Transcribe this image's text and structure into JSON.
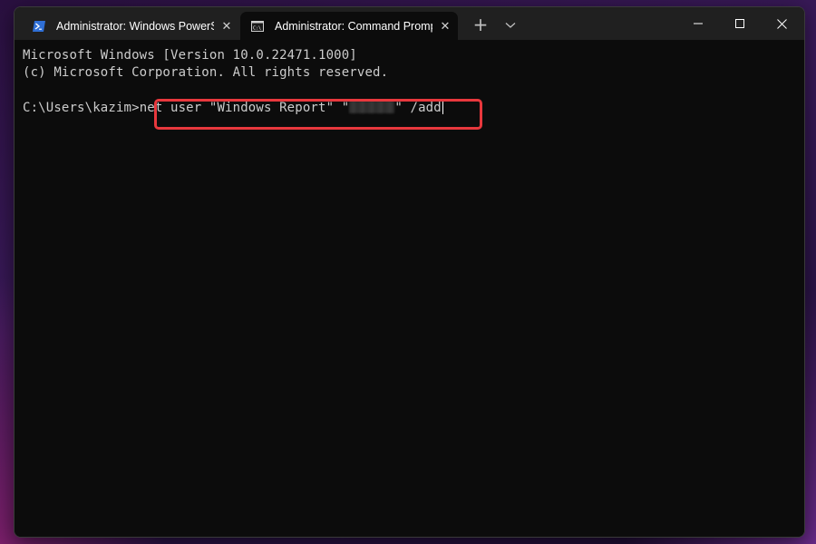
{
  "tabs": [
    {
      "title": "Administrator: Windows PowerShell",
      "icon": "powershell-icon",
      "active": false
    },
    {
      "title": "Administrator: Command Prompt",
      "icon": "cmd-icon",
      "active": true
    }
  ],
  "titlebar": {
    "new_tab_glyph": "+",
    "close_glyph": "✕"
  },
  "terminal": {
    "lines": [
      "Microsoft Windows [Version 10.0.22471.1000]",
      "(c) Microsoft Corporation. All rights reserved."
    ],
    "prompt": "C:\\Users\\kazim>",
    "command_part1": "net user \"Windows Report\" \"",
    "command_part2": "\" /add"
  },
  "colors": {
    "terminal_bg": "#0c0c0c",
    "titlebar_bg": "#202020",
    "text": "#cccccc",
    "highlight": "#e8383d",
    "powershell_blue": "#2f6fd6"
  }
}
